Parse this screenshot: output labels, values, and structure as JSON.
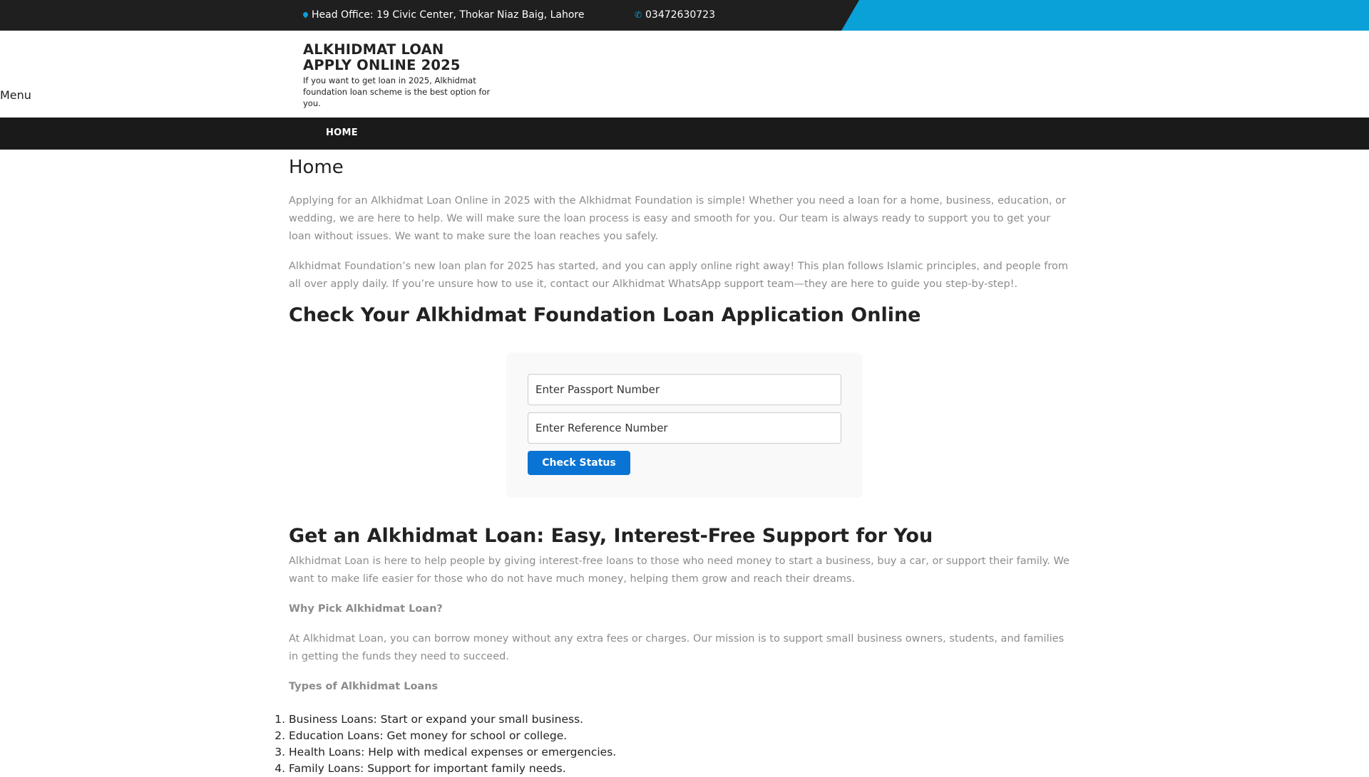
{
  "topbar": {
    "address": "Head Office: 19 Civic Center, Thokar Niaz Baig, Lahore",
    "phone": "03472630723",
    "accent_color": "#0aa0d8",
    "address_icon": "map-marker-icon",
    "phone_icon": "phone-icon"
  },
  "header": {
    "site_title": "ALKHIDMAT LOAN APPLY ONLINE 2025",
    "site_description": "If you want to get loan in 2025, Alkhidmat foundation loan scheme is the best option for you.",
    "menu_toggle": "Menu"
  },
  "nav": {
    "items": [
      {
        "label": "HOME"
      }
    ]
  },
  "main": {
    "page_title": "Home",
    "intro_paragraphs": [
      "Applying for an Alkhidmat Loan Online in 2025 with the Alkhidmat Foundation is simple! Whether you need a loan for a home, business, education, or wedding, we are here to help. We will make sure the loan process is easy and smooth for you. Our team is always ready to support you to get your loan without issues. We want to make sure the loan reaches you safely.",
      "Alkhidmat Foundation’s new loan plan for 2025 has started, and you can apply online right away! This plan follows Islamic principles, and people from all over apply daily. If you’re unsure how to use it, contact our Alkhidmat WhatsApp support team—they are here to guide you step-by-step!."
    ],
    "check_heading": "Check Your Alkhidmat Foundation Loan Application Online",
    "form": {
      "passport_placeholder": "Enter Passport Number",
      "reference_placeholder": "Enter Reference Number",
      "button_label": "Check Status",
      "button_color": "#0a74d4"
    },
    "loan_heading": "Get an Alkhidmat Loan: Easy, Interest-Free Support for You",
    "loan_intro": "Alkhidmat Loan is here to help people by giving interest-free loans to those who need money to start a business, buy a car, or support their family. We want to make life easier for those who do not have much money, helping them grow and reach their dreams.",
    "why_heading": "Why Pick Alkhidmat Loan?",
    "why_text": "At Alkhidmat Loan, you can borrow money without any extra fees or charges. Our mission is to support small business owners, students, and families in getting the funds they need to succeed.",
    "types_heading": "Types of Alkhidmat Loans",
    "types": [
      "Business Loans: Start or expand your small business.",
      "Education Loans: Get money for school or college.",
      "Health Loans: Help with medical expenses or emergencies.",
      "Family Loans: Support for important family needs."
    ]
  }
}
